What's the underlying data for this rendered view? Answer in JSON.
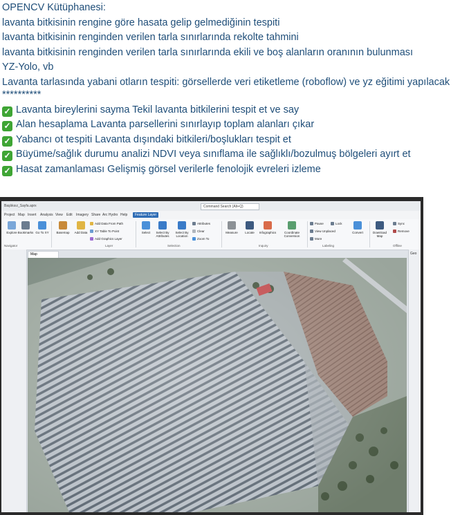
{
  "notes": {
    "lines": [
      "OPENCV Kütüphanesi:",
      "lavanta bitkisinin rengine göre hasata gelip gelmediğinin tespiti",
      "lavanta bitkisinin renginden verilen tarla sınırlarında rekolte tahmini",
      "lavanta bitkisinin renginden verilen tarla sınırlarında ekili ve boş alanların oranının bulunması",
      "YZ-Yolo, vb",
      "Lavanta tarlasında yabani otların tespiti: görsellerde veri etiketleme (roboflow) ve yz eğitimi yapılacak",
      "**********"
    ],
    "features": [
      "Lavanta bireylerini sayma Tekil lavanta bitkilerini tespit et ve say",
      "Alan hesaplama Lavanta parsellerini sınırlayıp toplam alanları çıkar",
      "Yabancı ot tespiti Lavanta dışındaki bitkileri/boşlukları tespit et",
      "Büyüme/sağlık durumu analizi NDVI veya sınıflama ile sağlıklı/bozulmuş bölgeleri ayırt et",
      "Hasat zamanlaması Gelişmiş görsel verilerle fenolojik evreleri izleme"
    ],
    "check_icon": "check-mark-emoji",
    "text_color": "#1f4e79",
    "check_color": "#3fa535"
  },
  "app": {
    "title_left": "Başlıksız_Sayfa.aprx",
    "command_search": "Command Search (Alt+Q)",
    "menu": [
      "Project",
      "Map",
      "Insert",
      "Analysis",
      "View",
      "Edit",
      "Imagery",
      "Share",
      "Arc Hydro",
      "Help",
      "Feature Layer"
    ],
    "active_menu": "Feature Layer",
    "ribbon": {
      "explore": "Explore",
      "bookmarks": "Bookmarks",
      "goto_xy": "Go To XY",
      "basemap": "Basemap",
      "add_data": "Add Data",
      "add_data_from_path": "Add Data From Path",
      "xy_table_to_point": "XY Table To Point",
      "add_graphics_layer": "Add Graphics Layer",
      "layer_group": "Layer",
      "select": "Select",
      "select_by_attributes": "Select By Attributes",
      "select_by_location": "Select By Location",
      "attributes": "Attributes",
      "clear": "Clear",
      "zoom_to": "Zoom To",
      "selection_group": "Selection",
      "measure": "Measure",
      "locate": "Locate",
      "infographics": "Infographics",
      "coordinate_conversion": "Coordinate Conversion",
      "inquiry_group": "Inquiry",
      "pause": "Pause",
      "lock": "Lock",
      "view_unplaced": "View Unplaced",
      "more": "More",
      "labeling_group": "Labeling",
      "convert": "Convert",
      "download_map": "Download Map",
      "sync": "Sync",
      "remove": "Remove",
      "offline_group": "Offline"
    },
    "navigator": "Navigator",
    "map_tab": "Map",
    "right_pane": "Geo"
  }
}
